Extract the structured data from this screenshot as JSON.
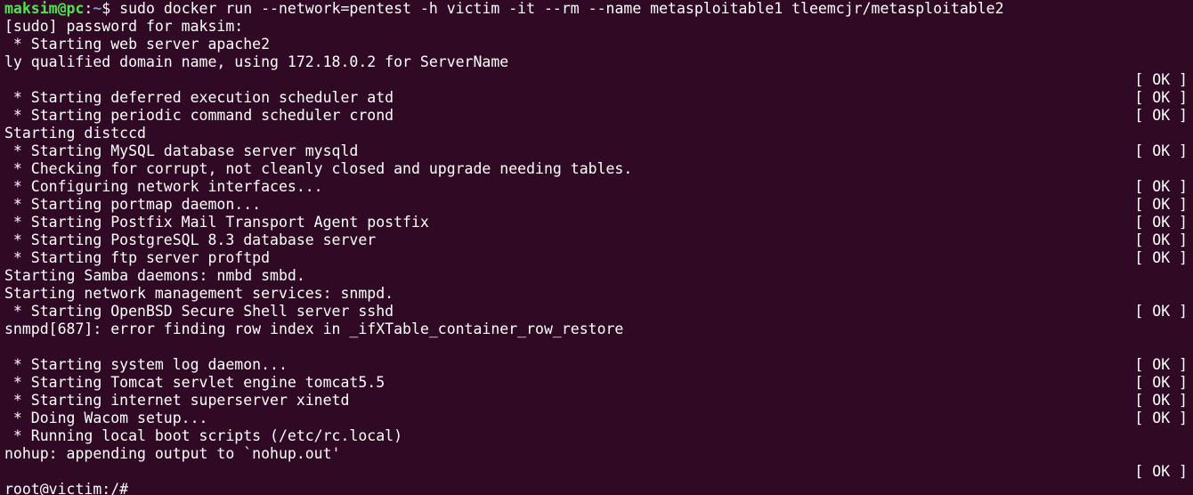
{
  "prompt": {
    "user_host": "maksim@pc",
    "separator": ":",
    "path": "~",
    "symbol": "$ ",
    "command": "sudo docker run --network=pentest -h victim -it --rm --name metasploitable1 tleemcjr/metasploitable2"
  },
  "lines": [
    {
      "text": "[sudo] password for maksim:",
      "status": ""
    },
    {
      "text": " * Starting web server apache2",
      "status": ""
    },
    {
      "text": "ly qualified domain name, using 172.18.0.2 for ServerName",
      "status": ""
    },
    {
      "text": "",
      "status": "[ OK ]"
    },
    {
      "text": " * Starting deferred execution scheduler atd",
      "status": "[ OK ]"
    },
    {
      "text": " * Starting periodic command scheduler crond",
      "status": "[ OK ]"
    },
    {
      "text": "Starting distccd",
      "status": ""
    },
    {
      "text": " * Starting MySQL database server mysqld",
      "status": "[ OK ]"
    },
    {
      "text": " * Checking for corrupt, not cleanly closed and upgrade needing tables.",
      "status": ""
    },
    {
      "text": " * Configuring network interfaces...",
      "status": "[ OK ]"
    },
    {
      "text": " * Starting portmap daemon...",
      "status": "[ OK ]"
    },
    {
      "text": " * Starting Postfix Mail Transport Agent postfix",
      "status": "[ OK ]"
    },
    {
      "text": " * Starting PostgreSQL 8.3 database server",
      "status": "[ OK ]"
    },
    {
      "text": " * Starting ftp server proftpd",
      "status": "[ OK ]"
    },
    {
      "text": "Starting Samba daemons: nmbd smbd.",
      "status": ""
    },
    {
      "text": "Starting network management services: snmpd.",
      "status": ""
    },
    {
      "text": " * Starting OpenBSD Secure Shell server sshd",
      "status": "[ OK ]"
    },
    {
      "text": "snmpd[687]: error finding row index in _ifXTable_container_row_restore",
      "status": ""
    },
    {
      "text": "",
      "status": ""
    },
    {
      "text": " * Starting system log daemon...",
      "status": "[ OK ]"
    },
    {
      "text": " * Starting Tomcat servlet engine tomcat5.5",
      "status": "[ OK ]"
    },
    {
      "text": " * Starting internet superserver xinetd",
      "status": "[ OK ]"
    },
    {
      "text": " * Doing Wacom setup...",
      "status": "[ OK ]"
    },
    {
      "text": " * Running local boot scripts (/etc/rc.local)",
      "status": ""
    },
    {
      "text": "nohup: appending output to `nohup.out'",
      "status": ""
    },
    {
      "text": "",
      "status": "[ OK ]"
    }
  ],
  "final_prompt": "root@victim:/# ",
  "colors": {
    "background": "#300a24",
    "text": "#ffffff",
    "user_host": "#4ee44e",
    "path": "#729fcf"
  }
}
